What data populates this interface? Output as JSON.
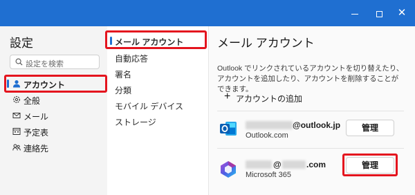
{
  "window": {
    "minimize_icon": "minimize-icon",
    "maximize_icon": "maximize-icon",
    "close_icon": "close-icon",
    "titlebar_color": "#1f6fd1"
  },
  "sidebar": {
    "title": "設定",
    "search": {
      "placeholder": "設定を検索",
      "icon": "search-icon"
    },
    "items": [
      {
        "label": "アカウント",
        "icon": "person-icon",
        "active": true
      },
      {
        "label": "全般",
        "icon": "gear-icon"
      },
      {
        "label": "メール",
        "icon": "mail-icon"
      },
      {
        "label": "予定表",
        "icon": "calendar-icon"
      },
      {
        "label": "連絡先",
        "icon": "people-icon"
      }
    ]
  },
  "subnav": {
    "items": [
      {
        "label": "メール アカウント",
        "active": true
      },
      {
        "label": "自動応答"
      },
      {
        "label": "署名"
      },
      {
        "label": "分類"
      },
      {
        "label": "モバイル デバイス"
      },
      {
        "label": "ストレージ"
      }
    ]
  },
  "main": {
    "title": "メール アカウント",
    "description": "Outlook でリンクされているアカウントを切り替えたり、アカウントを追加したり、アカウントを削除することができます。",
    "add_account": "アカウントの追加",
    "accounts": [
      {
        "email": "@outlook.jp",
        "provider": "Outlook.com",
        "manage": "管理",
        "icon": "outlook-icon"
      },
      {
        "email": "@",
        "email_domain": ".com",
        "provider": "Microsoft 365",
        "manage": "管理",
        "icon": "microsoft365-icon"
      }
    ]
  },
  "accent_color": "#1f6fd1",
  "highlight_color": "#e4141e"
}
